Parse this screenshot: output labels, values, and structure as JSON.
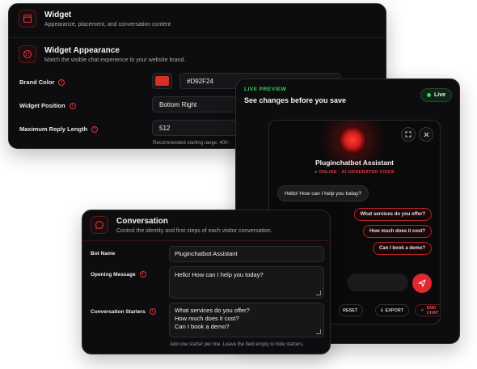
{
  "widget_section": {
    "title": "Widget",
    "subtitle": "Appearance, placement, and conversation content"
  },
  "appearance_section": {
    "title": "Widget Appearance",
    "subtitle": "Match the visible chat experience to your website brand.",
    "brand_color_label": "Brand Color",
    "brand_color_value": "#D92F24",
    "brand_color_hex": "#D92F24",
    "position_label": "Widget Position",
    "position_value": "Bottom Right",
    "max_reply_label": "Maximum Reply Length",
    "max_reply_value": "512",
    "max_reply_hint": "Recommended starting range: 400–"
  },
  "preview": {
    "kicker": "LIVE PREVIEW",
    "title": "See changes before you save",
    "live_label": "Live",
    "bot_name": "Pluginchatbot Assistant",
    "bot_status": "● ONLINE · AI-GENERATED VOICE",
    "greeting": "Hello! How can I help you today?",
    "starters": [
      "What services do you offer?",
      "How much does it cost?",
      "Can I book a demo?"
    ],
    "footer": {
      "reset": "RESET",
      "export": "EXPORT",
      "end_chat": "END CHAT"
    },
    "icons": {
      "expand": "expand-icon",
      "close": "close-icon",
      "send": "send-icon"
    }
  },
  "conversation_section": {
    "title": "Conversation",
    "subtitle": "Control the identity and first steps of each visitor conversation.",
    "bot_name_label": "Bot Name",
    "bot_name_value": "Pluginchatbot Assistant",
    "opening_label": "Opening Message",
    "opening_value": "Hello! How can I help you today?",
    "starters_label": "Conversation Starters",
    "starters_lines": [
      "What services do you offer?",
      "How much does it cost?",
      "Can I book a demo?"
    ],
    "starters_hint": "Add one starter per line. Leave the field empty to hide starters."
  },
  "colors": {
    "accent": "#D92F24",
    "live": "#37D35F",
    "background": "#0D0D0F"
  }
}
